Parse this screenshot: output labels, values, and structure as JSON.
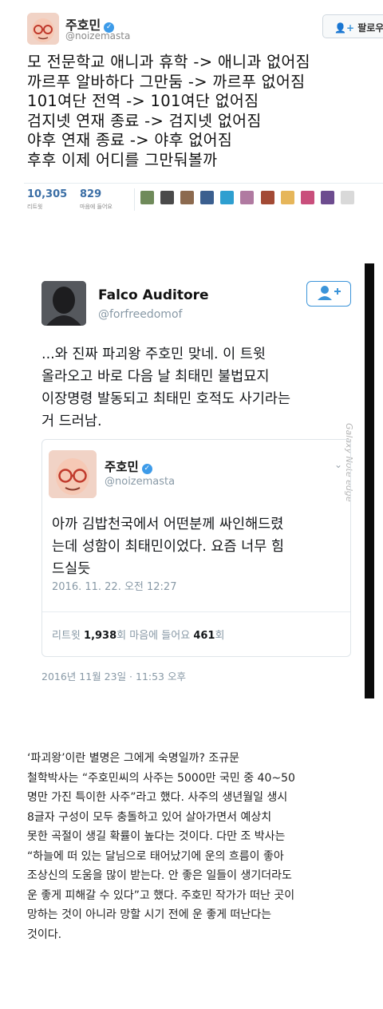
{
  "tweet1": {
    "name": "주호민",
    "handle": "@noizemasta",
    "follow_label": "팔로우",
    "lines": [
      "모 전문학교 애니과 휴학 -> 애니과 없어짐",
      "까르푸 알바하다 그만둠 -> 까르푸 없어짐",
      "101여단 전역 -> 101여단 없어짐",
      "검지넷 연재 종료 -> 검지넷 없어짐",
      "야후 연재 종료 -> 야후 없어짐",
      "후후 이제 어디를 그만둬볼까"
    ],
    "retweets": "10,305",
    "retweets_label": "리트윗",
    "likes": "829",
    "likes_label": "마음에 들어요"
  },
  "quote_tweet": {
    "name": "Falco Auditore",
    "handle": "@forfreedomof",
    "lines": [
      "...와 진짜 파괴왕 주호민 맞네. 이 트윗",
      "올라오고 바로 다음 날 최태민 불법묘지",
      "이장명령 발동되고 최태민 호적도 사기라는",
      "거 드러남."
    ],
    "date": "2016년 11월 23일 · 11:53 오후",
    "watermark": "Galaxy Note edge",
    "quoted": {
      "name": "주호민",
      "handle": "@noizemasta",
      "lines": [
        "아까 김밥천국에서 어떤분께 싸인해드렸",
        "는데 성함이 최태민이었다. 요즘 너무 힘",
        "드실듯"
      ],
      "date": "2016. 11. 22. 오전 12:27",
      "retweet_label": "리트윗",
      "retweets": "1,938",
      "count_unit": "회",
      "like_label": "마음에 들어요",
      "likes": "461"
    }
  },
  "article": {
    "lines": [
      "‘파괴왕’이란 별명은 그에게 숙명일까? 조규문",
      "철학박사는 “주호민씨의 사주는 5000만 국민 중 40~50",
      "명만 가진 특이한 사주”라고 했다. 사주의 생년월일 생시",
      "8글자 구성이 모두 충돌하고 있어 살아가면서 예상치",
      "못한 곡절이 생길 확률이 높다는 것이다. 다만 조 박사는",
      "“하늘에 떠 있는 달님으로 태어났기에 운의 흐름이 좋아",
      "조상신의 도움을 많이 받는다. 안 좋은 일들이 생기더라도",
      "운 좋게 피해갈 수 있다”고 했다. 주호민 작가가 떠난 곳이",
      "망하는 것이 아니라 망할 시기 전에 운 좋게 떠난다는",
      "것이다."
    ]
  },
  "colors": {
    "link_blue": "#3b94d9",
    "verified": "#3d9be9",
    "muted": "#8899a6"
  }
}
